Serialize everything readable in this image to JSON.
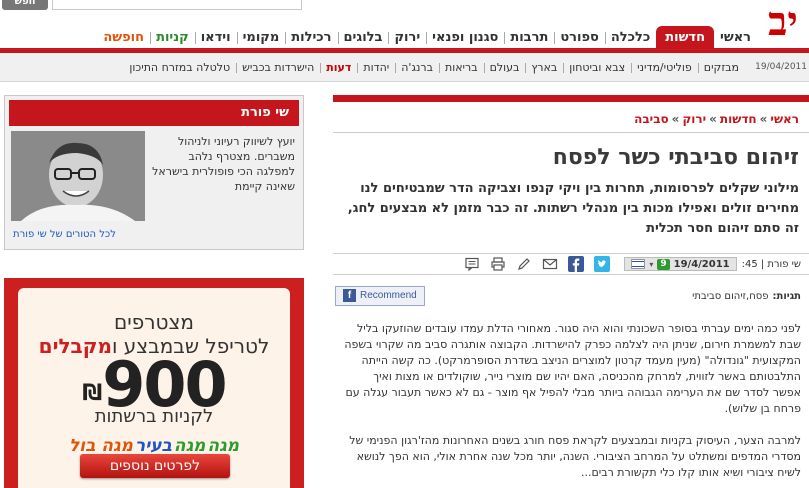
{
  "header": {
    "logo_text": "יב",
    "search_button_label": "חפש"
  },
  "nav": {
    "items": [
      {
        "label": "ראשי",
        "style": "normal"
      },
      {
        "label": "חדשות",
        "style": "active"
      },
      {
        "label": "כלכלה",
        "style": "normal"
      },
      {
        "label": "ספורט",
        "style": "normal"
      },
      {
        "label": "תרבות",
        "style": "normal"
      },
      {
        "label": "סגנון ופנאי",
        "style": "normal"
      },
      {
        "label": "ירוק",
        "style": "normal"
      },
      {
        "label": "בלוגים",
        "style": "normal"
      },
      {
        "label": "רכילות",
        "style": "normal"
      },
      {
        "label": "מקומי",
        "style": "normal"
      },
      {
        "label": "וידאו",
        "style": "normal"
      },
      {
        "label": "קניות",
        "style": "green"
      },
      {
        "label": "חופשה",
        "style": "orange"
      }
    ]
  },
  "subnav": {
    "date": "19/04/2011",
    "items": [
      {
        "label": "מבזקים",
        "highlight": false
      },
      {
        "label": "פוליטי/מדיני",
        "highlight": false
      },
      {
        "label": "צבא וביטחון",
        "highlight": false
      },
      {
        "label": "בארץ",
        "highlight": false
      },
      {
        "label": "בעולם",
        "highlight": false
      },
      {
        "label": "בריאות",
        "highlight": false
      },
      {
        "label": "ברנג'ה",
        "highlight": false
      },
      {
        "label": "יהדות",
        "highlight": false
      },
      {
        "label": "דעות",
        "highlight": true
      },
      {
        "label": "הישרדות בכביש",
        "highlight": false
      },
      {
        "label": "טלטלה במזרח התיכון",
        "highlight": false
      }
    ]
  },
  "article": {
    "breadcrumb": [
      "ראשי",
      "חדשות",
      "ירוק",
      "סביבה"
    ],
    "breadcrumb_sep": "»",
    "headline": "זיהום סביבתי כשר לפסח",
    "subheadline": "מילוני שקלים לפרסומות, תחרות בין ויקי קנפו וצביקה הדר שמבטיחים לנו מחירים זולים ואפילו מכות בין מנהלי רשתות. זה כבר מזמן לא מבצעים לחג, זה סתם זיהום חסר תכלית",
    "author": "שי פורת",
    "time": "| 45:",
    "date": "19/4/2011",
    "date_badge": "9",
    "tags_label": "תגיות:",
    "tags_value": "פסח,זיהום סביבתי",
    "recommend_label": "Recommend",
    "paragraphs": [
      "לפני כמה ימים עברתי בסופר השכונתי והוא היה סגור. מאחורי הדלת עמדו עובדים שהוזעקו בליל שבת למשמרת חירום, שניתן היה לצלמה כפרק להישרדות. הקבוצה אותגרה סביב מה שקרוי בשפה המקצועית \"גונדולה\" (מעין מעמד קרטון למוצרים הניצב בשדרת הסופרמרקט). כה קשה הייתה התלבטותם באשר לזווית, למרחק מהכניסה, האם יהיו שם מוצרי נייר, שוקולדים או מצות ואיך אפשר לסדר שם את הערימה הגבוהה ביותר מבלי להפיל אף מוצר - גם לא כאשר תעבור עגלה עם פרחח בן שלוש).",
      "למרבה הצער, העיסוק בקניות ובמבצעים לקראת פסח חורג בשנים האחרונות מהז'רגון הפנימי של מסדרי המדפים ומשתלט על המרחב הציבורי. השנה, יותר מכל שנה אחרת אולי, הוא הפך לנושא לשיח ציבורי ושיא אותו קלו כלי תקשורת רבים..."
    ]
  },
  "column": {
    "header": "שי פורת",
    "bio": "יועץ לשיווק רעיוני ולניהול משברים. מצטרף נלהב למפלגה הכי פופולרית בישראל שאינה קיימת",
    "link": "לכל הטורים של שי פורת"
  },
  "ad": {
    "line1": "מצטרפים",
    "line2_a": "לטריפל שבמבצע ו",
    "line2_b": "מקבלים",
    "price": "900",
    "currency": "₪",
    "line3": "לקניות ברשתות",
    "brands": [
      {
        "name": "מגה",
        "color": "#2e9b2e"
      },
      {
        "name": "מגה",
        "color": "#2e9b2e"
      },
      {
        "name": "בעיר",
        "color": "#1f56c0"
      },
      {
        "name": "מגה בול",
        "color": "#e0540a"
      }
    ],
    "cta": "לפרטים נוספים"
  },
  "colors": {
    "brand_red": "#c4161c",
    "link_blue": "#1f56c0",
    "green": "#2e9b2e",
    "orange": "#e0540a"
  }
}
